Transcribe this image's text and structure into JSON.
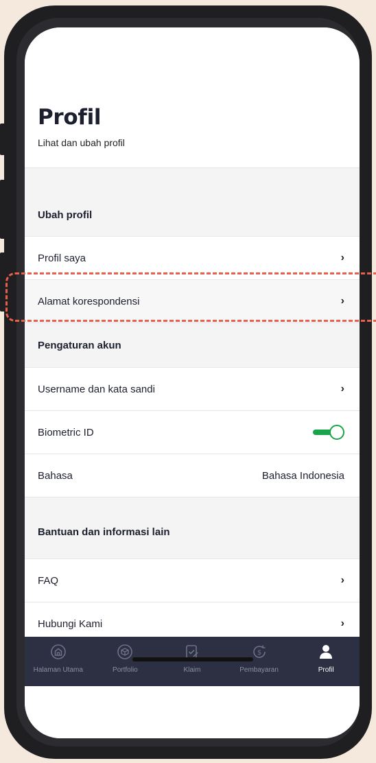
{
  "header": {
    "title": "Profil",
    "subtitle": "Lihat dan ubah profil"
  },
  "sections": {
    "edit_profile": {
      "title": "Ubah profil",
      "items": [
        {
          "label": "Profil saya"
        },
        {
          "label": "Alamat korespondensi"
        }
      ]
    },
    "account_settings": {
      "title": "Pengaturan akun",
      "items": [
        {
          "label": "Username dan kata sandi"
        },
        {
          "label": "Biometric ID",
          "toggle_on": true
        },
        {
          "label": "Bahasa",
          "value": "Bahasa Indonesia"
        }
      ]
    },
    "help": {
      "title": "Bantuan dan informasi lain",
      "items": [
        {
          "label": "FAQ"
        },
        {
          "label": "Hubungi Kami"
        }
      ]
    }
  },
  "tabbar": {
    "items": [
      {
        "label": "Halaman Utama",
        "icon": "home-icon"
      },
      {
        "label": "Portfolio",
        "icon": "box-icon"
      },
      {
        "label": "Klaim",
        "icon": "claim-icon"
      },
      {
        "label": "Pembayaran",
        "icon": "payment-icon"
      },
      {
        "label": "Profil",
        "icon": "person-icon",
        "active": true
      }
    ]
  },
  "colors": {
    "accent_green": "#1aa34a",
    "tabbar_bg": "#2c3042",
    "highlight": "#e8604c"
  }
}
